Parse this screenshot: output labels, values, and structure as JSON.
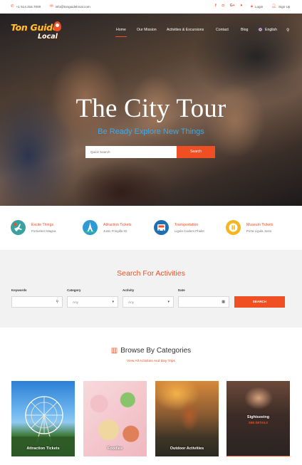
{
  "topbar": {
    "phone": "+1 514.316.7000",
    "email": "info@tonguidelocal.com",
    "login": "Login",
    "signup": "Sign Up"
  },
  "brand": {
    "line1": "Ton Guide",
    "line2": "Local"
  },
  "nav": {
    "items": [
      "Home",
      "Our Mission",
      "Activities & Excursions",
      "Contact",
      "Blog"
    ],
    "language": "English",
    "active_index": 0
  },
  "hero": {
    "title": "The City Tour",
    "subtitle": "Be Ready Explore New Things",
    "search_placeholder": "Quick Search",
    "search_button": "Search"
  },
  "features": [
    {
      "title": "Excite Things",
      "subtitle": "Portuelect Magna",
      "color": "#3aa1a0"
    },
    {
      "title": "Attraction Tickets",
      "subtitle": "Justo Fringilla Xit",
      "color": "#2d9ad6"
    },
    {
      "title": "Transportation",
      "subtitle": "Ligula Cuidem Phalet",
      "color": "#1f6fb5"
    },
    {
      "title": "Museum Tickets",
      "subtitle": "Porta Ligula Justo",
      "color": "#f3b61f"
    }
  ],
  "search_activities": {
    "title": "Search For Activities",
    "labels": {
      "keywords": "Keywords",
      "category": "Category",
      "activity": "Activity",
      "date": "Date"
    },
    "category_value": "Any",
    "activity_value": "Any",
    "button": "SEARCH"
  },
  "categories": {
    "title": "Browse By Categories",
    "link": "View All Activities And Day Trips",
    "cards": [
      {
        "label": "Attraction Tickets"
      },
      {
        "label": "Foodies"
      },
      {
        "label": "Outdoor Activities"
      },
      {
        "label": "Sightseeing",
        "sub": "SEE DETAILS"
      }
    ]
  }
}
